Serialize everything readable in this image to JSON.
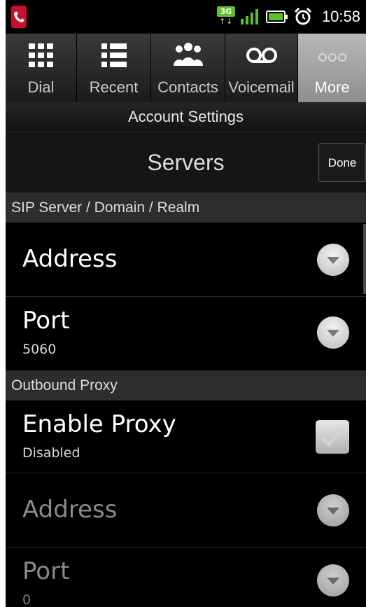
{
  "status": {
    "network": "3G",
    "time": "10:58"
  },
  "tabs": [
    {
      "label": "Dial",
      "icon": "dialpad-icon"
    },
    {
      "label": "Recent",
      "icon": "list-icon"
    },
    {
      "label": "Contacts",
      "icon": "people-icon"
    },
    {
      "label": "Voicemail",
      "icon": "voicemail-icon"
    },
    {
      "label": "More",
      "icon": "more-icon",
      "active": true
    }
  ],
  "page": {
    "title": "Account Settings",
    "header": "Servers",
    "done_label": "Done"
  },
  "sections": {
    "sip": {
      "title": "SIP Server / Domain / Realm",
      "address": {
        "title": "Address"
      },
      "port": {
        "title": "Port",
        "value": "5060"
      }
    },
    "proxy": {
      "title": "Outbound Proxy",
      "enable": {
        "title": "Enable Proxy",
        "value": "Disabled"
      },
      "address": {
        "title": "Address"
      },
      "port": {
        "title": "Port",
        "value": "0"
      }
    }
  },
  "colors": {
    "active_tab": "#a3a3a3",
    "app_icon": "#c8102e",
    "network_badge": "#5fbf2a",
    "signal": "#5fbf2a"
  }
}
